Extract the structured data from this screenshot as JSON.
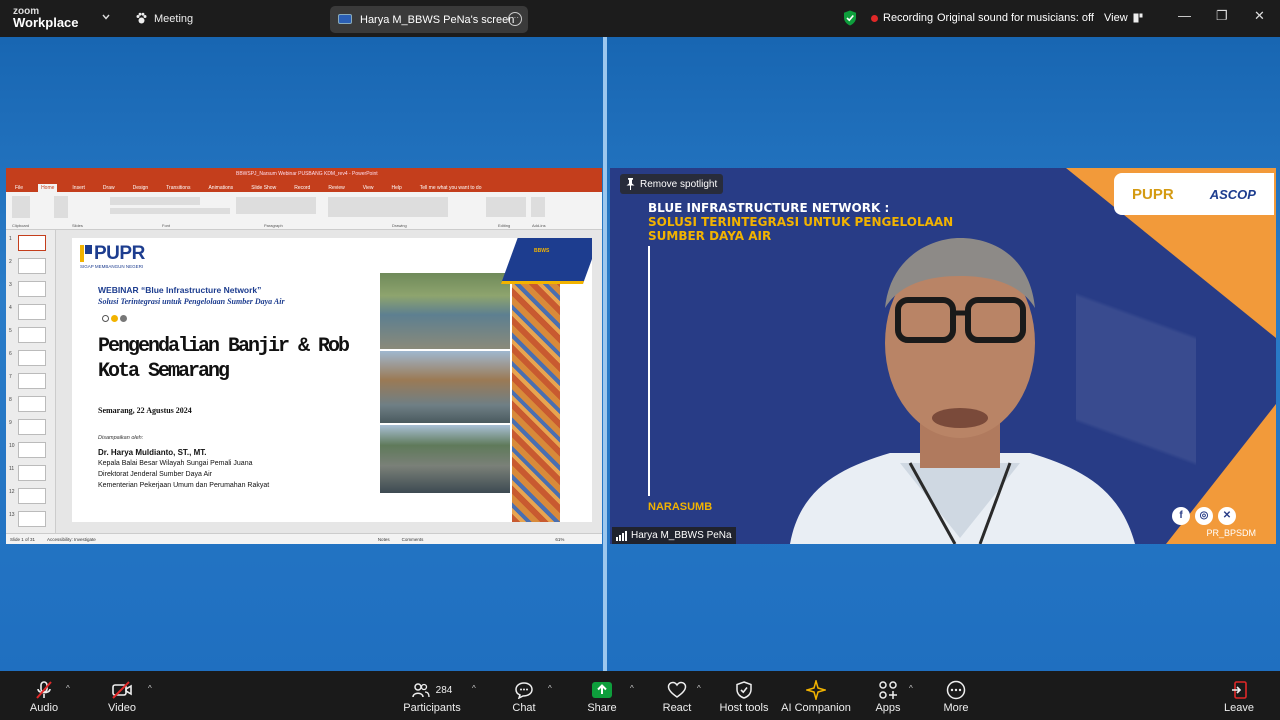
{
  "app": {
    "brand_top": "zoom",
    "brand_bottom": "Workplace",
    "meeting_label": "Meeting"
  },
  "screen_share": {
    "label": "Harya M_BBWS PeNa's screen"
  },
  "status": {
    "recording": "Recording",
    "original_sound": "Original sound for musicians: off",
    "view": "View"
  },
  "window_controls": {
    "minimize": "—",
    "restore": "❐",
    "close": "✕"
  },
  "ppt": {
    "title": "BBWSPJ_Narsum Webinar PUSBANG KDM_rev4 - PowerPoint",
    "tabs": [
      "File",
      "Home",
      "Insert",
      "Draw",
      "Design",
      "Transitions",
      "Animations",
      "Slide Show",
      "Record",
      "Review",
      "View",
      "Help",
      "Tell me what you want to do"
    ],
    "ribbon_groups": [
      "Clipboard",
      "Slides",
      "Font",
      "Paragraph",
      "Drawing",
      "Editing",
      "Add-ins"
    ],
    "thumb_numbers": [
      "1",
      "2",
      "3",
      "4",
      "5",
      "6",
      "7",
      "8",
      "9",
      "10",
      "11",
      "12",
      "13"
    ],
    "status_left": "Slide 1 of 31",
    "status_access": "Accessibility: Investigate",
    "status_notes": "Notes",
    "status_comments": "Comments",
    "status_zoom": "61%"
  },
  "slide": {
    "logo": "PUPR",
    "logo_tag": "SIGAP MEMBANGUN NEGERI",
    "webinar": "WEBINAR “Blue Infrastructure Network”",
    "subtitle": "Solusi Terintegrasi untuk Pengelolaan Sumber Daya Air",
    "heading_line1": "Pengendalian Banjir & Rob",
    "heading_line2": "Kota Semarang",
    "date": "Semarang, 22 Agustus 2024",
    "presented_by": "Disampaikan oleh:",
    "presenter": "Dr. Harya Muldianto, ST., MT.",
    "line1": "Kepala Balai Besar Wilayah Sungai Pemali Juana",
    "line2": "Direktorat Jenderal Sumber Daya Air",
    "line3": "Kementerian Pekerjaan Umum dan Perumahan Rakyat",
    "badge": "BBWS"
  },
  "video": {
    "spotlight": "Remove spotlight",
    "title1": "BLUE INFRASTRUCTURE NETWORK :",
    "title2": "SOLUSI TERINTEGRASI UNTUK PENGELOLAAN",
    "title3": "SUMBER DAYA AIR",
    "narasumber": "NARASUMB",
    "handle": "PR_BPSDM",
    "logo1": "PUPR",
    "logo2": "ASCOP",
    "participant_name": "Harya M_BBWS PeNa"
  },
  "toolbar": {
    "audio": "Audio",
    "video": "Video",
    "participants": "Participants",
    "participants_count": "284",
    "chat": "Chat",
    "share": "Share",
    "react": "React",
    "host_tools": "Host tools",
    "ai_companion": "AI Companion",
    "apps": "Apps",
    "more": "More",
    "leave": "Leave"
  },
  "colors": {
    "accent_green": "#0e9e3c",
    "record_red": "#e02828",
    "leave_red": "#e02828",
    "ppt_red": "#c43e1c",
    "pupr_blue": "#1d3d8f",
    "pupr_yellow": "#f2b300"
  }
}
